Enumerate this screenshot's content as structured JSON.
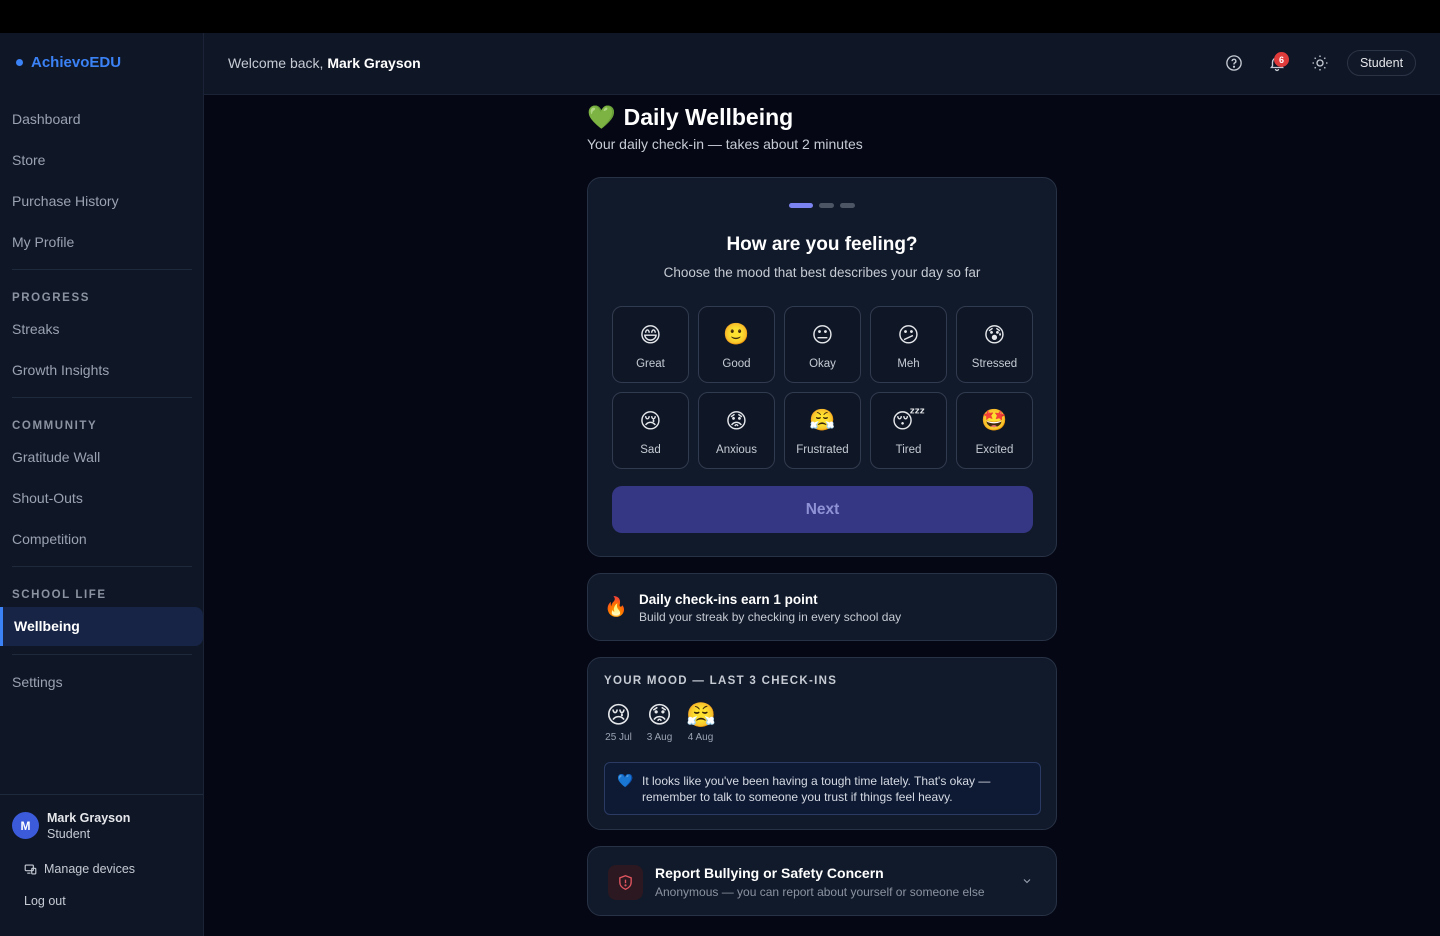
{
  "brand": {
    "name": "AchievoEDU"
  },
  "sidebar": {
    "items": [
      {
        "label": "Dashboard"
      },
      {
        "label": "Store"
      },
      {
        "label": "Purchase History"
      },
      {
        "label": "My Profile"
      }
    ],
    "progress": {
      "title": "PROGRESS",
      "items": [
        {
          "label": "Streaks"
        },
        {
          "label": "Growth Insights"
        }
      ]
    },
    "community": {
      "title": "COMMUNITY",
      "items": [
        {
          "label": "Gratitude Wall"
        },
        {
          "label": "Shout-Outs"
        },
        {
          "label": "Competition"
        }
      ]
    },
    "school_life": {
      "title": "SCHOOL LIFE",
      "items": [
        {
          "label": "Wellbeing"
        }
      ]
    },
    "settings": {
      "label": "Settings"
    },
    "user": {
      "initial": "M",
      "name": "Mark Grayson",
      "role": "Student"
    },
    "manage_devices": "Manage devices",
    "logout": "Log out"
  },
  "header": {
    "welcome_prefix": "Welcome back,",
    "welcome_name": "Mark Grayson",
    "notifications_count": "6",
    "role_label": "Student",
    "icons": [
      "help-icon",
      "bell-icon",
      "sun-icon"
    ]
  },
  "page": {
    "title_emoji": "💚",
    "title": "Daily Wellbeing",
    "subtitle": "Your daily check-in — takes about 2 minutes"
  },
  "mood_card": {
    "step_current": 1,
    "step_total": 3,
    "question": "How are you feeling?",
    "hint": "Choose the mood that best describes your day so far",
    "moods": [
      {
        "emoji": "😄",
        "label": "Great"
      },
      {
        "emoji": "🙂",
        "label": "Good"
      },
      {
        "emoji": "😐",
        "label": "Okay"
      },
      {
        "emoji": "😕",
        "label": "Meh"
      },
      {
        "emoji": "😰",
        "label": "Stressed"
      },
      {
        "emoji": "😢",
        "label": "Sad"
      },
      {
        "emoji": "😟",
        "label": "Anxious"
      },
      {
        "emoji": "😤",
        "label": "Frustrated"
      },
      {
        "emoji": "😴",
        "label": "Tired"
      },
      {
        "emoji": "🤩",
        "label": "Excited"
      }
    ],
    "next_label": "Next"
  },
  "points": {
    "emoji": "🔥",
    "title": "Daily check-ins earn 1 point",
    "subtitle": "Build your streak by checking in every school day"
  },
  "history": {
    "title": "YOUR MOOD — LAST 3 CHECK-INS",
    "entries": [
      {
        "emoji": "😢",
        "date": "25 Jul"
      },
      {
        "emoji": "😟",
        "date": "3 Aug"
      },
      {
        "emoji": "😤",
        "date": "4 Aug"
      }
    ],
    "support_emoji": "💙",
    "support_message": "It looks like you've been having a tough time lately. That's okay — remember to talk to someone you trust if things feel heavy."
  },
  "report": {
    "title": "Report Bullying or Safety Concern",
    "subtitle": "Anonymous — you can report about yourself or someone else"
  },
  "colors": {
    "accent": "#3b82f6",
    "button": "#363784",
    "badge": "#e03b3b",
    "step_active": "#7b83f0",
    "step_inactive": "#4b5563"
  }
}
